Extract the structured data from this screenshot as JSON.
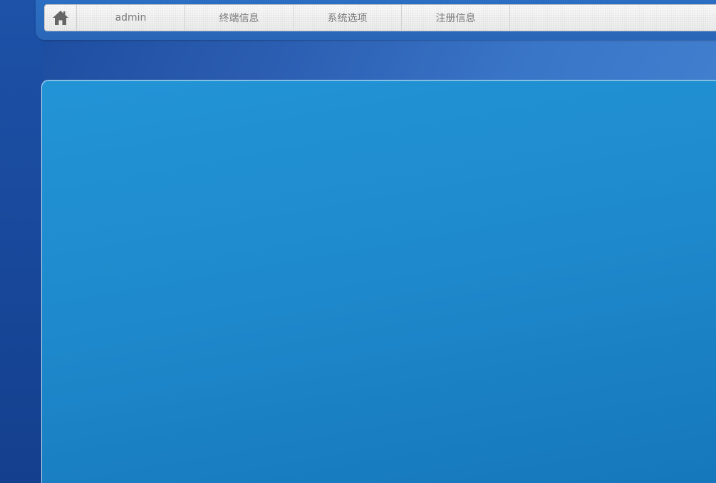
{
  "nav": {
    "home_icon": "home-icon",
    "items": [
      {
        "label": "admin"
      },
      {
        "label": "终端信息"
      },
      {
        "label": "系统选项"
      },
      {
        "label": "注册信息"
      }
    ]
  },
  "colors": {
    "background": "#2a5cb0",
    "panel": "#1e8acd",
    "nav_text": "#7a7a7a"
  }
}
